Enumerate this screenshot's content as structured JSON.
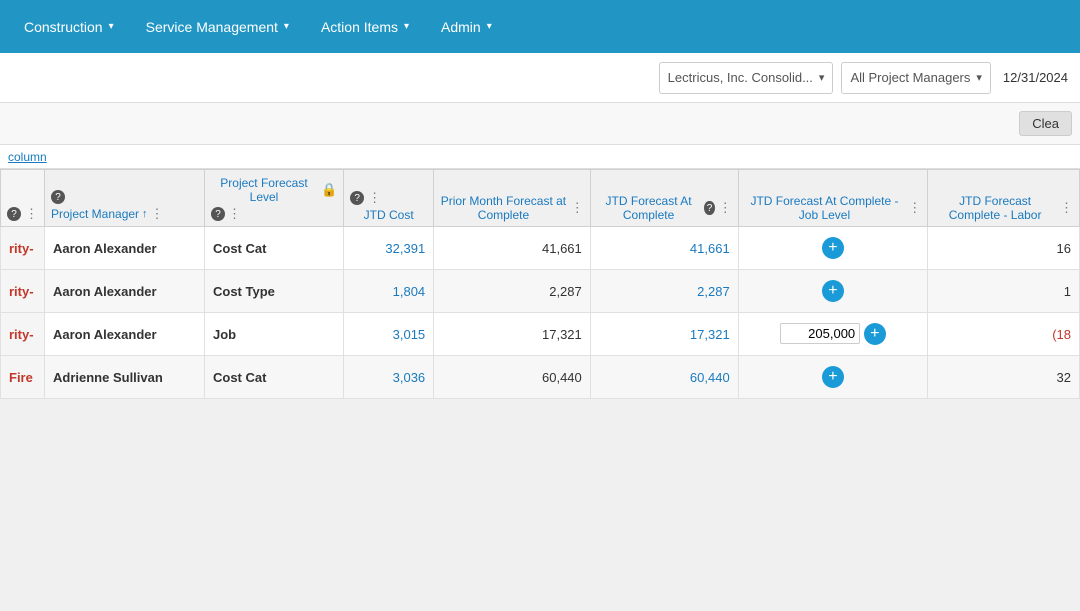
{
  "navbar": {
    "items": [
      {
        "label": "Construction",
        "id": "construction"
      },
      {
        "label": "Service Management",
        "id": "service-management"
      },
      {
        "label": "Action Items",
        "id": "action-items"
      },
      {
        "label": "Admin",
        "id": "admin"
      }
    ]
  },
  "filters": {
    "company": "Lectricus, Inc. Consolid...",
    "manager": "All Project Managers",
    "date": "12/31/2024",
    "clear_label": "Clea"
  },
  "column_link": "column",
  "table": {
    "headers": [
      {
        "id": "col0",
        "label": "",
        "has_q": true,
        "has_menu": true
      },
      {
        "id": "project-manager",
        "label": "Project Manager",
        "has_q": true,
        "has_sort": true,
        "has_menu": true
      },
      {
        "id": "forecast-level",
        "label": "Project Forecast Level",
        "has_lock": true,
        "has_q": true,
        "has_menu": true
      },
      {
        "id": "jtd-cost",
        "label": "JTD Cost",
        "has_q": true,
        "has_menu": true
      },
      {
        "id": "prior-month",
        "label": "Prior Month Forecast at Complete",
        "has_q": false,
        "has_menu": true
      },
      {
        "id": "jtd-forecast",
        "label": "JTD Forecast At Complete",
        "has_q": true,
        "has_menu": true
      },
      {
        "id": "jtd-forecast-job",
        "label": "JTD Forecast At Complete - Job Level",
        "has_q": false,
        "has_menu": true
      },
      {
        "id": "jtd-forecast-labor",
        "label": "JTD Forecast Complete - Labor",
        "has_q": false,
        "has_menu": true
      }
    ],
    "rows": [
      {
        "prefix": "rity-",
        "manager": "Aaron Alexander",
        "level": "Cost Cat",
        "jtd_cost": "32,391",
        "prior_month": "41,661",
        "jtd_forecast": "41,661",
        "jtd_forecast_job": "",
        "jtd_labor": "16",
        "has_plus_job": true,
        "has_input_job": false,
        "labor_red": false
      },
      {
        "prefix": "rity-",
        "manager": "Aaron Alexander",
        "level": "Cost Type",
        "jtd_cost": "1,804",
        "prior_month": "2,287",
        "jtd_forecast": "2,287",
        "jtd_forecast_job": "",
        "jtd_labor": "1",
        "has_plus_job": true,
        "has_input_job": false,
        "labor_red": false
      },
      {
        "prefix": "rity-",
        "manager": "Aaron Alexander",
        "level": "Job",
        "jtd_cost": "3,015",
        "prior_month": "17,321",
        "jtd_forecast": "17,321",
        "jtd_forecast_job": "205,000",
        "jtd_labor": "(18",
        "has_plus_job": true,
        "has_input_job": true,
        "labor_red": true
      },
      {
        "prefix": "Fire",
        "manager": "Adrienne Sullivan",
        "level": "Cost Cat",
        "jtd_cost": "3,036",
        "prior_month": "60,440",
        "jtd_forecast": "60,440",
        "jtd_forecast_job": "",
        "jtd_labor": "32",
        "has_plus_job": true,
        "has_input_job": false,
        "labor_red": false
      }
    ]
  }
}
